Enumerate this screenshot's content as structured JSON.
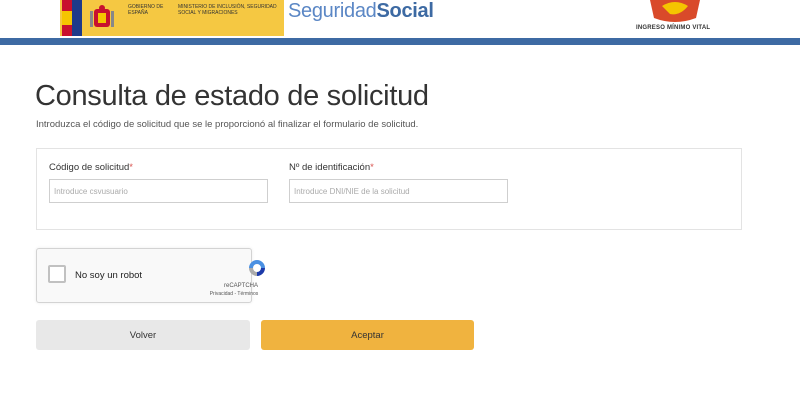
{
  "header": {
    "gov_text": "Gobierno de España",
    "ministry_text": "Ministerio de Inclusión, Seguridad Social y Migraciones",
    "ss_logo_light": "Seguridad",
    "ss_logo_bold": "Social",
    "imv_label": "INGRESO MÍNIMO VITAL",
    "colors": {
      "gov_yellow": "#f5c842",
      "bar_blue": "#3d6aa3"
    }
  },
  "main": {
    "title": "Consulta de estado de solicitud",
    "subtitle": "Introduzca el código de solicitud que se le proporcionó al finalizar el formulario de solicitud."
  },
  "form": {
    "code_label": "Código de solicitud",
    "code_placeholder": "Introduce csvusuario",
    "id_label": "Nº de identificación",
    "id_placeholder": "Introduce DNI/NIE de la solicitud",
    "required_mark": "*"
  },
  "recaptcha": {
    "label": "No soy un robot",
    "brand": "reCAPTCHA",
    "links": "Privacidad - Términos"
  },
  "buttons": {
    "back_label": "Volver",
    "accept_label": "Aceptar",
    "accept_color": "#f0b33f"
  }
}
